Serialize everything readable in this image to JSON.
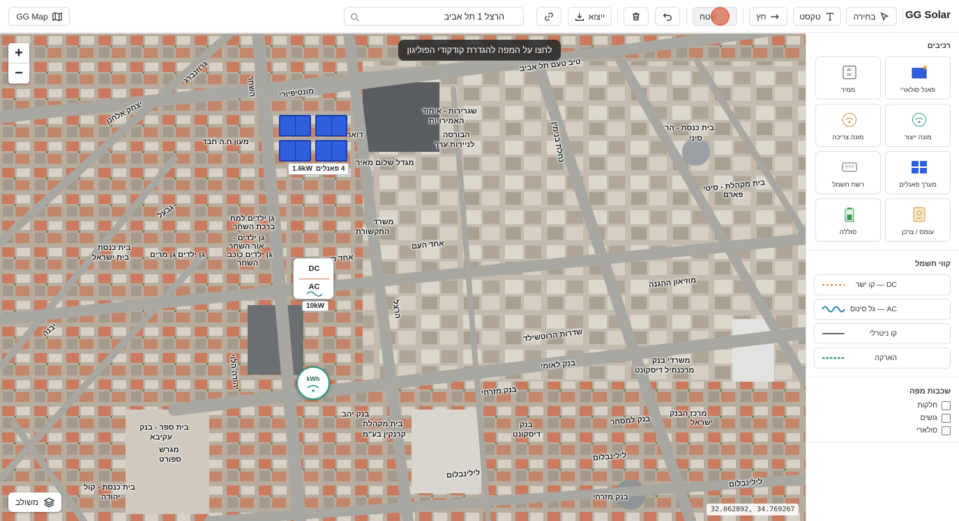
{
  "brand": "GG Solar",
  "toolbar": {
    "select_label": "בחירה",
    "text_label": "טקסט",
    "arrow_label": "חץ",
    "area_label": "שטח",
    "export_label": "ייצוא",
    "map_label": "GG Map",
    "search_value": "הרצל 1 תל אביב"
  },
  "map": {
    "hint": "לחצו על המפה להגדרת קודקודי הפוליגון",
    "zoom_in": "+",
    "zoom_out": "−",
    "panel_group_count": "4 פאנלים",
    "panel_group_power": "1.6kW",
    "inverter_dc": "DC",
    "inverter_ac": "AC",
    "inverter_power": "10kW",
    "meter_label": "kWh",
    "layers_button": "משולב",
    "coordinates": "32.062892, 34.769267",
    "streets": [
      "מונטיפיורי",
      "טיב טעם תל אביב",
      "שגרירות - איחוד",
      "האמירויות",
      "הבורסה",
      "לניירות ערך",
      "מגדל שלום מאיר",
      "משרד",
      "התקשורת",
      "אחד העם",
      "אחד העם",
      "מוזיאון ההגנה",
      "שדרות הרוטשילד",
      "בית כנסת - הר",
      "סיני",
      "בית מקהלת - סיטי",
      "פארם",
      "גן ילדים למח",
      "ברכת השחר",
      "גן ילדים -",
      "אור השחר",
      "גן ילדים כוכב",
      "השחר",
      "יצחק אלחנן",
      "מעון ח.ה חבד",
      "דואר",
      "גן ילדים גן מרים",
      "בית כנסת",
      "בית ישראל",
      "בנק לאומי",
      "בנק מזרחי",
      "בנק יהב",
      "בית מקהלת",
      "קרנקין בע\"מ",
      "בנק",
      "דיסקונט",
      "בנק למסחר",
      "מרכז הבנק",
      "ישראל",
      "משרדי בנק",
      "מרכנתיל דיסקונט",
      "בית ספר - בנק",
      "עקיבא",
      "מגרש",
      "ספורט",
      "בית כנסת - קול",
      "יהודה",
      "לילינבלום",
      "לילינבלום",
      "לילינבלום",
      "נחלת בנימין",
      "הרצל",
      "יהודה הלוי",
      "השחר",
      "גרוזנברג",
      "גבעל",
      "יבנה",
      "בנק מזרחי"
    ]
  },
  "sidebar": {
    "components_title": "רכיבים",
    "components": [
      {
        "label": "פאנל סולארי",
        "icon": "solar-panel-icon"
      },
      {
        "label": "ממיר",
        "icon": "inverter-icon"
      },
      {
        "label": "מונה ייצור",
        "icon": "production-meter-icon"
      },
      {
        "label": "מונה צריכה",
        "icon": "consumption-meter-icon"
      },
      {
        "label": "מערך פאנלים",
        "icon": "panel-array-icon"
      },
      {
        "label": "רשת חשמל",
        "icon": "power-grid-icon"
      },
      {
        "label": "עומס / צרכן",
        "icon": "load-icon"
      },
      {
        "label": "סוללה",
        "icon": "battery-icon"
      }
    ],
    "lines_title": "קווי חשמל",
    "lines": [
      {
        "label": "DC — קו ישר",
        "color": "#e07a3c"
      },
      {
        "label": "AC — גל סינוס",
        "color": "#2f7fa8"
      },
      {
        "label": "קו ניטרלי",
        "color": "#333333"
      },
      {
        "label": "הארקה",
        "color": "#2f9d6a"
      }
    ],
    "layers_title": "שכבות מפה",
    "layers": [
      "חלקות",
      "גושים",
      "סולארי"
    ]
  }
}
